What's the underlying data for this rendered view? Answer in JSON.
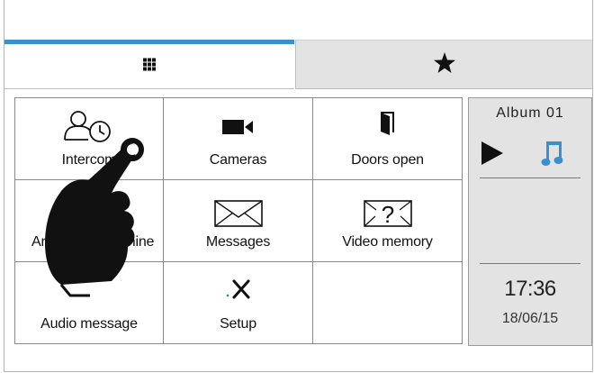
{
  "tabs": [
    {
      "icon": "grid-icon",
      "active": true
    },
    {
      "icon": "star-icon",
      "active": false
    }
  ],
  "grid": {
    "items": [
      {
        "label": "Intercom",
        "icon": "intercom-icon"
      },
      {
        "label": "Cameras",
        "icon": "camera-icon"
      },
      {
        "label": "Doors open",
        "icon": "door-icon"
      },
      {
        "label": "Answering machine",
        "icon": "answering-icon"
      },
      {
        "label": "Messages",
        "icon": "envelope-icon"
      },
      {
        "label": "Video memory",
        "icon": "video-memory-icon"
      },
      {
        "label": "Audio message",
        "icon": "audio-message-icon"
      },
      {
        "label": "Setup",
        "icon": "setup-icon"
      },
      {
        "label": "",
        "icon": ""
      }
    ]
  },
  "side": {
    "album": "Album 01",
    "time": "17:36",
    "date": "18/06/15"
  },
  "colors": {
    "accent": "#3a8fd0",
    "note": "#3a8fd0",
    "panel": "#e3e3e3"
  }
}
